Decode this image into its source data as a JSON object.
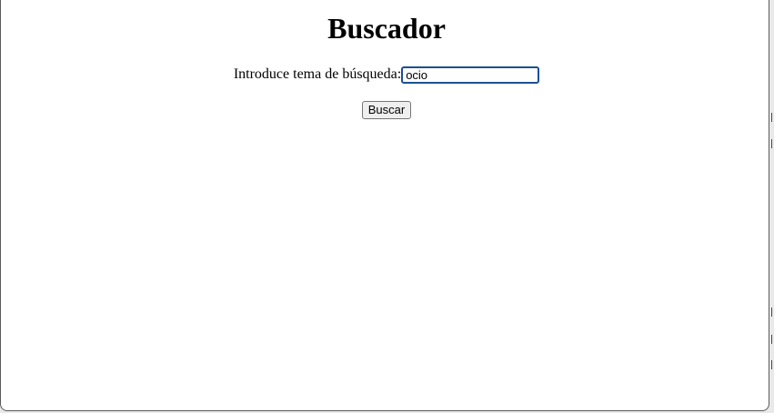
{
  "page": {
    "title": "Buscador"
  },
  "search": {
    "label": "Introduce tema de búsqueda:",
    "value": "ocio",
    "button_label": "Buscar"
  }
}
